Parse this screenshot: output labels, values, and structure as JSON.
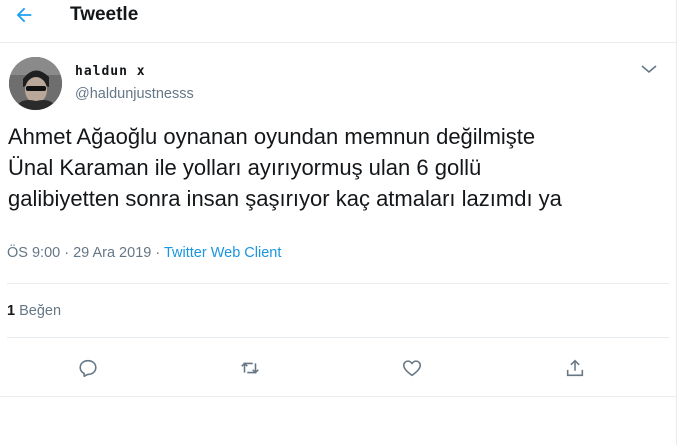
{
  "header": {
    "title": "Tweetle",
    "back_icon": "arrow-left-icon"
  },
  "author": {
    "name": "haldun x",
    "handle": "@haldunjustnesss"
  },
  "tweet": {
    "text": "Ahmet Ağaoğlu oynanan oyundan memnun değilmişte\nÜnal Karaman ile yolları ayırıyormuş ulan 6 gollü\ngalibiyetten sonra insan şaşırıyor kaç atmaları lazımdı ya",
    "time": "ÖS 9:00",
    "date": "29 Ara 2019",
    "separator": "·",
    "client": "Twitter Web Client"
  },
  "stats": {
    "likes_count": "1",
    "likes_label": "Beğen"
  },
  "actions": {
    "reply_icon": "reply-icon",
    "retweet_icon": "retweet-icon",
    "like_icon": "heart-icon",
    "share_icon": "share-icon"
  },
  "colors": {
    "accent": "#1b95e0",
    "secondary_text": "#657786",
    "divider": "#e6ecf0"
  }
}
